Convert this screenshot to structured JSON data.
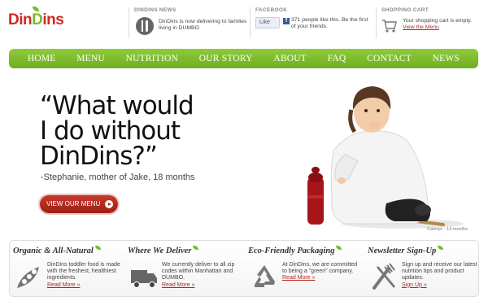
{
  "brand": {
    "logo_part1": "Din",
    "logo_part2": "D",
    "logo_part3": "ins"
  },
  "header": {
    "news": {
      "title": "DINDINS NEWS",
      "text": "DinDins is now delivering to families living in DUMBO"
    },
    "facebook": {
      "title": "FACEBOOK",
      "like_label": "Like",
      "text": "371 people like this. Be the first of your friends."
    },
    "cart": {
      "title": "SHOPPING CART",
      "text": "Your shopping cart is empty.",
      "link": "View the Menu"
    }
  },
  "nav": [
    "HOME",
    "MENU",
    "NUTRITION",
    "OUR STORY",
    "ABOUT",
    "FAQ",
    "CONTACT",
    "NEWS"
  ],
  "hero": {
    "quote_line1": "“What would",
    "quote_line2": "I do without",
    "quote_line3": "DinDins?”",
    "attribution": "-Stephanie, mother of Jake, 18 months",
    "button": "VIEW OUR MENU",
    "photo_caption": "Camryn - 14 months"
  },
  "features": [
    {
      "title": "Organic & All-Natural",
      "icon": "peas-pod-icon",
      "text": "DinDins toddler food is made with the freshest, healthiest ingredients.",
      "link": "Read More »"
    },
    {
      "title": "Where We Deliver",
      "icon": "delivery-truck-icon",
      "text": "We currently deliver to all zip codes within Manhattan and DUMBO.",
      "link": "Read More »"
    },
    {
      "title": "Eco-Friendly Packaging",
      "icon": "recycle-icon",
      "text": "At DinDins, we are committed to being a \"green\" company.",
      "link": "Read More »"
    },
    {
      "title": "Newsletter Sign-Up",
      "icon": "fork-knife-icon",
      "text": "Sign up and receive our latest nutrition tips and product updates.",
      "link": "Sign Up »"
    }
  ],
  "colors": {
    "brand_red": "#d02a1e",
    "brand_green": "#7ab82e",
    "nav_green": "#7fbd2e",
    "link_red": "#b5261c"
  }
}
